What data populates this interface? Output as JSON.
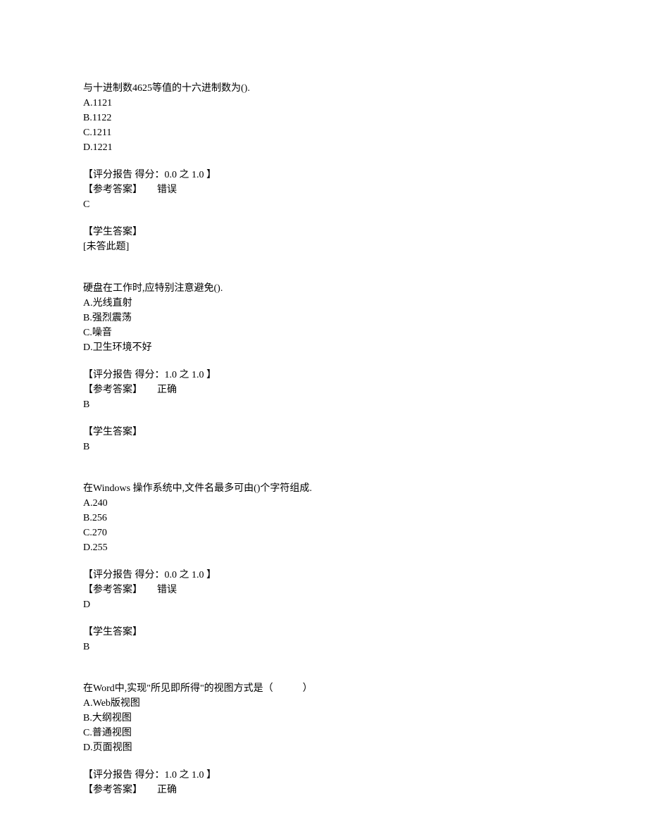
{
  "questions": [
    {
      "stem": "与十进制数4625等值的十六进制数为().",
      "options": [
        "A.1121",
        "B.1122",
        "C.1211",
        "D.1221"
      ],
      "score_line": "【评分报告 得分：0.0 之 1.0 】",
      "ref_label": "【参考答案】",
      "ref_status": "错误",
      "ref_answer": "C",
      "student_label": "【学生答案】",
      "student_answer": "[未答此题]"
    },
    {
      "stem": "硬盘在工作时,应特别注意避免().",
      "options": [
        "A.光线直射",
        "B.强烈震荡",
        "C.噪音",
        "D.卫生环境不好"
      ],
      "score_line": "【评分报告 得分：1.0 之 1.0 】",
      "ref_label": "【参考答案】",
      "ref_status": "正确",
      "ref_answer": "B",
      "student_label": "【学生答案】",
      "student_answer": "B"
    },
    {
      "stem": "在Windows 操作系统中,文件名最多可由()个字符组成.",
      "options": [
        "A.240",
        "B.256",
        "C.270",
        "D.255"
      ],
      "score_line": "【评分报告 得分：0.0 之 1.0 】",
      "ref_label": "【参考答案】",
      "ref_status": "错误",
      "ref_answer": "D",
      "student_label": "【学生答案】",
      "student_answer": "B"
    },
    {
      "stem": "在Word中,实现\"所见即所得\"的视图方式是（　　　）",
      "options": [
        "A.Web版视图",
        "B.大纲视图",
        "C.普通视图",
        "D.页面视图"
      ],
      "score_line": "【评分报告 得分：1.0 之 1.0 】",
      "ref_label": "【参考答案】",
      "ref_status": "正确",
      "ref_answer": "",
      "student_label": "",
      "student_answer": ""
    }
  ]
}
